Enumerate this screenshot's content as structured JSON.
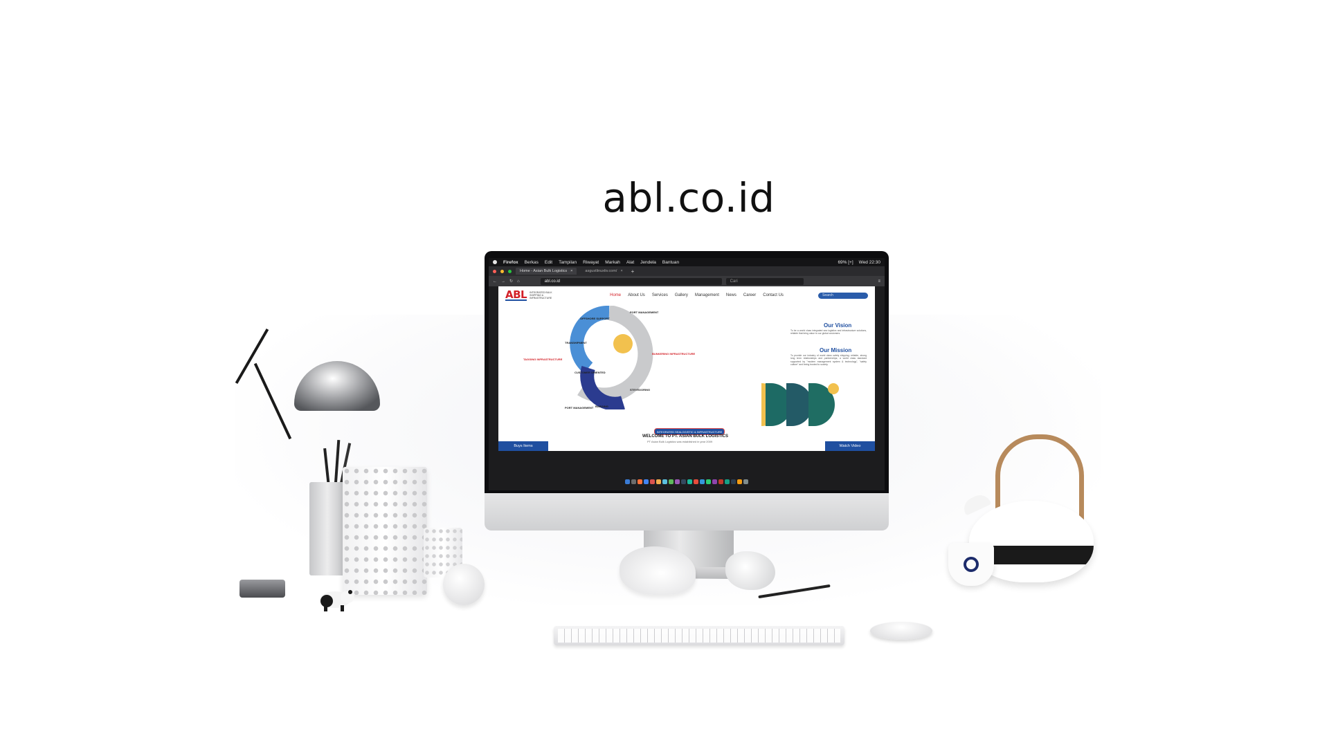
{
  "title": "abl.co.id",
  "menubar": {
    "items": [
      "Firefox",
      "Berkas",
      "Edit",
      "Tampilan",
      "Riwayat",
      "Markah",
      "Alat",
      "Jendela",
      "Bantuan"
    ],
    "status": [
      "69% [+]",
      "Wed 22:30"
    ]
  },
  "browser": {
    "tabs": [
      "Home - Asian Bulk Logistics",
      "asgustlinuxtiv.com/"
    ],
    "url": "abl.co.id",
    "search_placeholder": "Cari"
  },
  "site": {
    "logo": "ABL",
    "logo_tagline": "INTEGRATED BULK SHIPPING & INFRASTRUCTURE",
    "nav": [
      "Home",
      "About Us",
      "Services",
      "Gallery",
      "Management",
      "News",
      "Career",
      "Contact Us"
    ],
    "search_placeholder": "Search",
    "vision_heading": "Our Vision",
    "vision_text": "To be a world class integrated sea logistics and infrastructure solutions, reliable that bring value to our global customers.",
    "mission_heading": "Our Mission",
    "mission_text": "To provide our industry of world class safety shipping; reliable, strong long term relationships and partnerships; a world class standard supported by \"modern management system & technology\", \"safety culture\" and being trusted to society.",
    "cycle": {
      "offshore": "OFFSHORE SUPPORT",
      "port": "PORT MANAGEMENT",
      "transhipment": "TRANSHIPMENT",
      "bunkering": "BUNKERING INFRASTRUCTURE",
      "tagging": "TAGGING INFRASTRUCTURE",
      "customer": "CUSTOMER ORIENTED",
      "stevedoring": "STEVEDORING",
      "port2": "PORT MANAGEMENT",
      "barging": "BARGING"
    },
    "banner": "INTEGRATED SEALOGISTIC & INFRASTRUCTURE",
    "hero_title": "WELCOME TO PT. ASIAN BULK LOGISTICS",
    "hero_sub": "PT Asian Bulk Logistics was established in year 2009",
    "cta_left": "Buys Items",
    "cta_right": "Watch Video"
  },
  "colors": {
    "brand_red": "#d32027",
    "brand_blue": "#1f4fa0"
  }
}
